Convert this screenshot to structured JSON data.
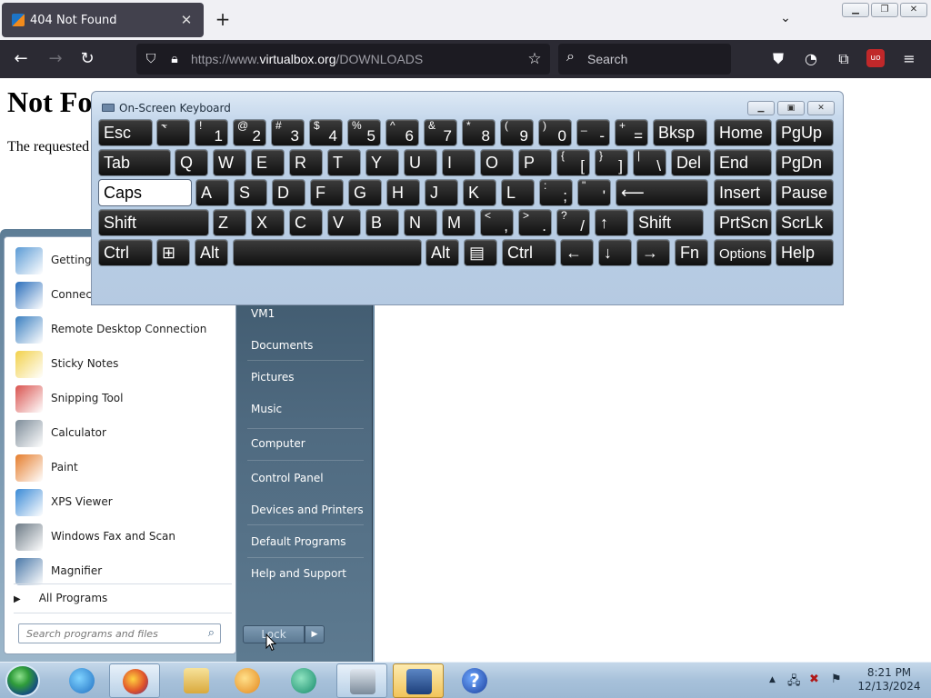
{
  "browser": {
    "tab_title": "404 Not Found",
    "tab_close": "✕",
    "new_tab": "+",
    "url_prefix": "https://www.",
    "url_domain": "virtualbox.org",
    "url_path": "/DOWNLOADS",
    "search_placeholder": "Search",
    "accent": "#2b2a33"
  },
  "page": {
    "heading": "Not Fo",
    "paragraph": "The requested"
  },
  "osk": {
    "title": "On-Screen Keyboard",
    "rows": [
      [
        {
          "main": "Esc"
        },
        {
          "sup": "~",
          "main": "`"
        },
        {
          "sup": "!",
          "sub": "1"
        },
        {
          "sup": "@",
          "sub": "2"
        },
        {
          "sup": "#",
          "sub": "3"
        },
        {
          "sup": "$",
          "sub": "4"
        },
        {
          "sup": "%",
          "sub": "5"
        },
        {
          "sup": "^",
          "sub": "6"
        },
        {
          "sup": "&",
          "sub": "7"
        },
        {
          "sup": "*",
          "sub": "8"
        },
        {
          "sup": "(",
          "sub": "9"
        },
        {
          "sup": ")",
          "sub": "0"
        },
        {
          "sup": "_",
          "sub": "-"
        },
        {
          "sup": "+",
          "sub": "="
        },
        {
          "main": "Bksp"
        },
        {
          "main": "Home"
        },
        {
          "main": "PgUp"
        }
      ],
      [
        {
          "main": "Tab"
        },
        {
          "main": "Q"
        },
        {
          "main": "W"
        },
        {
          "main": "E"
        },
        {
          "main": "R"
        },
        {
          "main": "T"
        },
        {
          "main": "Y"
        },
        {
          "main": "U"
        },
        {
          "main": "I"
        },
        {
          "main": "O"
        },
        {
          "main": "P"
        },
        {
          "sup": "{",
          "sub": "["
        },
        {
          "sup": "}",
          "sub": "]"
        },
        {
          "sup": "|",
          "sub": "\\"
        },
        {
          "main": "Del"
        },
        {
          "main": "End"
        },
        {
          "main": "PgDn"
        }
      ],
      [
        {
          "main": "Caps"
        },
        {
          "main": "A"
        },
        {
          "main": "S"
        },
        {
          "main": "D"
        },
        {
          "main": "F"
        },
        {
          "main": "G"
        },
        {
          "main": "H"
        },
        {
          "main": "J"
        },
        {
          "main": "K"
        },
        {
          "main": "L"
        },
        {
          "sup": ":",
          "sub": ";"
        },
        {
          "sup": "\"",
          "sub": "'"
        },
        {
          "main": "⟵"
        },
        {
          "main": "Insert"
        },
        {
          "main": "Pause"
        }
      ],
      [
        {
          "main": "Shift"
        },
        {
          "main": "Z"
        },
        {
          "main": "X"
        },
        {
          "main": "C"
        },
        {
          "main": "V"
        },
        {
          "main": "B"
        },
        {
          "main": "N"
        },
        {
          "main": "M"
        },
        {
          "sup": "<",
          "sub": ","
        },
        {
          "sup": ">",
          "sub": "."
        },
        {
          "sup": "?",
          "sub": "/"
        },
        {
          "main": "↑"
        },
        {
          "main": "Shift"
        },
        {
          "main": "PrtScn"
        },
        {
          "main": "ScrLk"
        }
      ],
      [
        {
          "main": "Ctrl"
        },
        {
          "main": "⊞"
        },
        {
          "main": "Alt"
        },
        {
          "main": ""
        },
        {
          "main": "Alt"
        },
        {
          "main": "▤"
        },
        {
          "main": "Ctrl"
        },
        {
          "main": "←"
        },
        {
          "main": "↓"
        },
        {
          "main": "→"
        },
        {
          "main": "Fn"
        },
        {
          "main": "Options"
        },
        {
          "main": "Help"
        }
      ]
    ]
  },
  "start_menu": {
    "programs": [
      {
        "label": "Getting S",
        "icon": "getting-started-icon"
      },
      {
        "label": "Connect t",
        "icon": "connect-projector-icon"
      },
      {
        "label": "Remote Desktop Connection",
        "icon": "remote-desktop-icon"
      },
      {
        "label": "Sticky Notes",
        "icon": "sticky-notes-icon"
      },
      {
        "label": "Snipping Tool",
        "icon": "snipping-tool-icon"
      },
      {
        "label": "Calculator",
        "icon": "calculator-icon"
      },
      {
        "label": "Paint",
        "icon": "paint-icon"
      },
      {
        "label": "XPS Viewer",
        "icon": "xps-viewer-icon"
      },
      {
        "label": "Windows Fax and Scan",
        "icon": "fax-scan-icon"
      },
      {
        "label": "Magnifier",
        "icon": "magnifier-icon"
      }
    ],
    "all_programs": "All Programs",
    "search_placeholder": "Search programs and files",
    "right_links": [
      "VM1",
      "Documents",
      "Pictures",
      "Music",
      "Computer",
      "Control Panel",
      "Devices and Printers",
      "Default Programs",
      "Help and Support"
    ],
    "lock_label": "Lock"
  },
  "taskbar": {
    "time": "8:21 PM",
    "date": "12/13/2024",
    "items": [
      "internet-explorer-icon",
      "firefox-icon",
      "explorer-icon",
      "media-player-icon",
      "network-icon",
      "osk-icon",
      "action-center-icon",
      "help-icon"
    ]
  }
}
